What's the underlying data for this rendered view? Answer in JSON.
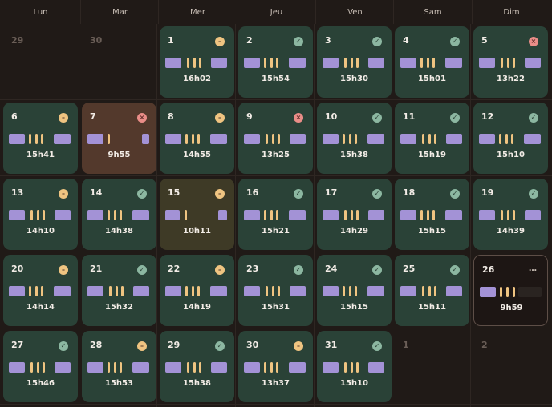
{
  "weekdays": [
    "Lun",
    "Mar",
    "Mer",
    "Jeu",
    "Ven",
    "Sam",
    "Dim"
  ],
  "colors": {
    "background": "#201a17",
    "done_cell": "#2a4237",
    "missed_cell": "#53392c",
    "partial_cell": "#3e3a26",
    "sleep_bar": "#a392d6",
    "wake_tick": "#efc481",
    "status_ok": "#8cb7a1",
    "status_partial": "#efc481",
    "status_error": "#ea8d88"
  },
  "icons": {
    "ok": "✓",
    "partial": "–",
    "error": "×",
    "more": "…"
  },
  "weeks": [
    [
      {
        "day": "29",
        "kind": "outside"
      },
      {
        "day": "30",
        "kind": "outside"
      },
      {
        "day": "1",
        "kind": "green",
        "status": "partial",
        "duration": "16h02"
      },
      {
        "day": "2",
        "kind": "green",
        "status": "ok",
        "duration": "15h54"
      },
      {
        "day": "3",
        "kind": "green",
        "status": "ok",
        "duration": "15h30"
      },
      {
        "day": "4",
        "kind": "green",
        "status": "ok",
        "duration": "15h01"
      },
      {
        "day": "5",
        "kind": "green",
        "status": "err",
        "duration": "13h22"
      }
    ],
    [
      {
        "day": "6",
        "kind": "green",
        "status": "partial",
        "duration": "15h41"
      },
      {
        "day": "7",
        "kind": "brown",
        "status": "err",
        "duration": "9h55"
      },
      {
        "day": "8",
        "kind": "green",
        "status": "partial",
        "duration": "14h55"
      },
      {
        "day": "9",
        "kind": "green",
        "status": "err",
        "duration": "13h25"
      },
      {
        "day": "10",
        "kind": "green",
        "status": "ok",
        "duration": "15h38"
      },
      {
        "day": "11",
        "kind": "green",
        "status": "ok",
        "duration": "15h19"
      },
      {
        "day": "12",
        "kind": "green",
        "status": "ok",
        "duration": "15h10"
      }
    ],
    [
      {
        "day": "13",
        "kind": "green",
        "status": "partial",
        "duration": "14h10"
      },
      {
        "day": "14",
        "kind": "green",
        "status": "ok",
        "duration": "14h38"
      },
      {
        "day": "15",
        "kind": "olive",
        "status": "partial",
        "duration": "10h11"
      },
      {
        "day": "16",
        "kind": "green",
        "status": "ok",
        "duration": "15h21"
      },
      {
        "day": "17",
        "kind": "green",
        "status": "ok",
        "duration": "14h29"
      },
      {
        "day": "18",
        "kind": "green",
        "status": "ok",
        "duration": "15h15"
      },
      {
        "day": "19",
        "kind": "green",
        "status": "ok",
        "duration": "14h39"
      }
    ],
    [
      {
        "day": "20",
        "kind": "green",
        "status": "partial",
        "duration": "14h14"
      },
      {
        "day": "21",
        "kind": "green",
        "status": "ok",
        "duration": "15h32"
      },
      {
        "day": "22",
        "kind": "green",
        "status": "partial",
        "duration": "14h19"
      },
      {
        "day": "23",
        "kind": "green",
        "status": "ok",
        "duration": "15h31"
      },
      {
        "day": "24",
        "kind": "green",
        "status": "ok",
        "duration": "15h15"
      },
      {
        "day": "25",
        "kind": "green",
        "status": "ok",
        "duration": "15h11"
      },
      {
        "day": "26",
        "kind": "today",
        "status": "more",
        "duration": "9h59"
      }
    ],
    [
      {
        "day": "27",
        "kind": "green",
        "status": "ok",
        "duration": "15h46"
      },
      {
        "day": "28",
        "kind": "green",
        "status": "partial",
        "duration": "15h53"
      },
      {
        "day": "29",
        "kind": "green",
        "status": "ok",
        "duration": "15h38"
      },
      {
        "day": "30",
        "kind": "green",
        "status": "partial",
        "duration": "13h37"
      },
      {
        "day": "31",
        "kind": "green",
        "status": "ok",
        "duration": "15h10"
      },
      {
        "day": "1",
        "kind": "outside"
      },
      {
        "day": "2",
        "kind": "outside"
      }
    ]
  ]
}
